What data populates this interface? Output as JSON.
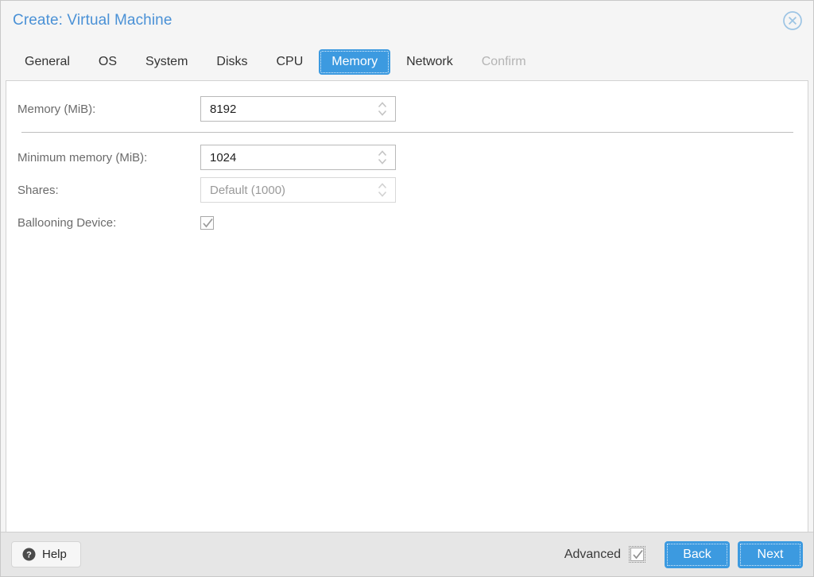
{
  "window": {
    "title": "Create: Virtual Machine",
    "close_icon": "close-circle-icon"
  },
  "tabs": [
    {
      "label": "General",
      "state": "normal"
    },
    {
      "label": "OS",
      "state": "normal"
    },
    {
      "label": "System",
      "state": "normal"
    },
    {
      "label": "Disks",
      "state": "normal"
    },
    {
      "label": "CPU",
      "state": "normal"
    },
    {
      "label": "Memory",
      "state": "active"
    },
    {
      "label": "Network",
      "state": "normal"
    },
    {
      "label": "Confirm",
      "state": "disabled"
    }
  ],
  "form": {
    "memory": {
      "label": "Memory (MiB):",
      "value": "8192",
      "placeholder": ""
    },
    "minimum_memory": {
      "label": "Minimum memory (MiB):",
      "value": "1024",
      "placeholder": ""
    },
    "shares": {
      "label": "Shares:",
      "value": "",
      "placeholder": "Default (1000)"
    },
    "ballooning": {
      "label": "Ballooning Device:",
      "checked": "true"
    }
  },
  "footer": {
    "help_label": "Help",
    "help_icon": "question-mark-circle-icon",
    "advanced_label": "Advanced",
    "advanced_checked": "true",
    "back_label": "Back",
    "next_label": "Next"
  },
  "colors": {
    "accent": "#3c9ae0",
    "title": "#4a91d6",
    "label": "#6b6b6b",
    "disabled_tab": "#b4b4b4",
    "footer_bg": "#e6e6e6"
  }
}
